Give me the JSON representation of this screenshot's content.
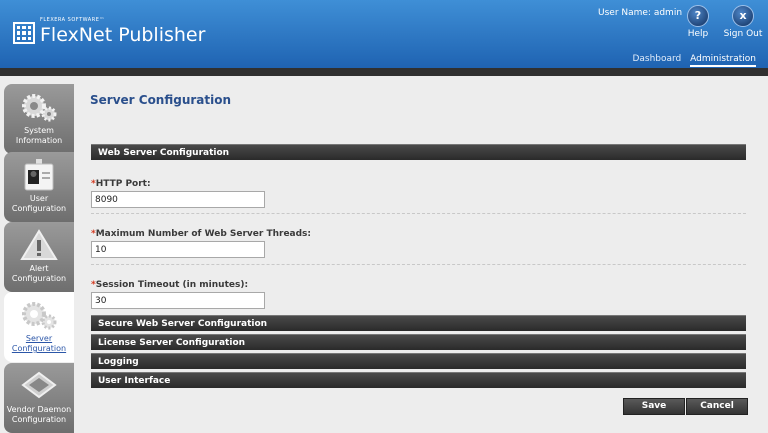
{
  "header": {
    "brand_small": "FLEXERA SOFTWARE™",
    "brand_name": "FlexNet Publisher",
    "user_name": "User Name: admin",
    "help_label": "Help",
    "signout_label": "Sign Out",
    "nav": {
      "dashboard": "Dashboard",
      "administration": "Administration"
    }
  },
  "sidebar": {
    "items": [
      {
        "label1": "System",
        "label2": "Information"
      },
      {
        "label1": "User",
        "label2": "Configuration"
      },
      {
        "label1": "Alert",
        "label2": "Configuration"
      },
      {
        "label1": "Server",
        "label2": "Configuration"
      },
      {
        "label1": "Vendor Daemon",
        "label2": "Configuration"
      }
    ]
  },
  "main": {
    "title": "Server Configuration",
    "web_section": "Web Server Configuration",
    "http_port_label": "HTTP Port:",
    "http_port_value": "8090",
    "threads_label": "Maximum Number of Web Server Threads:",
    "threads_value": "10",
    "timeout_label": "Session Timeout (in minutes):",
    "timeout_value": "30",
    "sections": [
      "Secure Web Server Configuration",
      "License Server Configuration",
      "Logging",
      "User Interface"
    ],
    "save": "Save",
    "cancel": "Cancel",
    "required_mark": "*"
  }
}
